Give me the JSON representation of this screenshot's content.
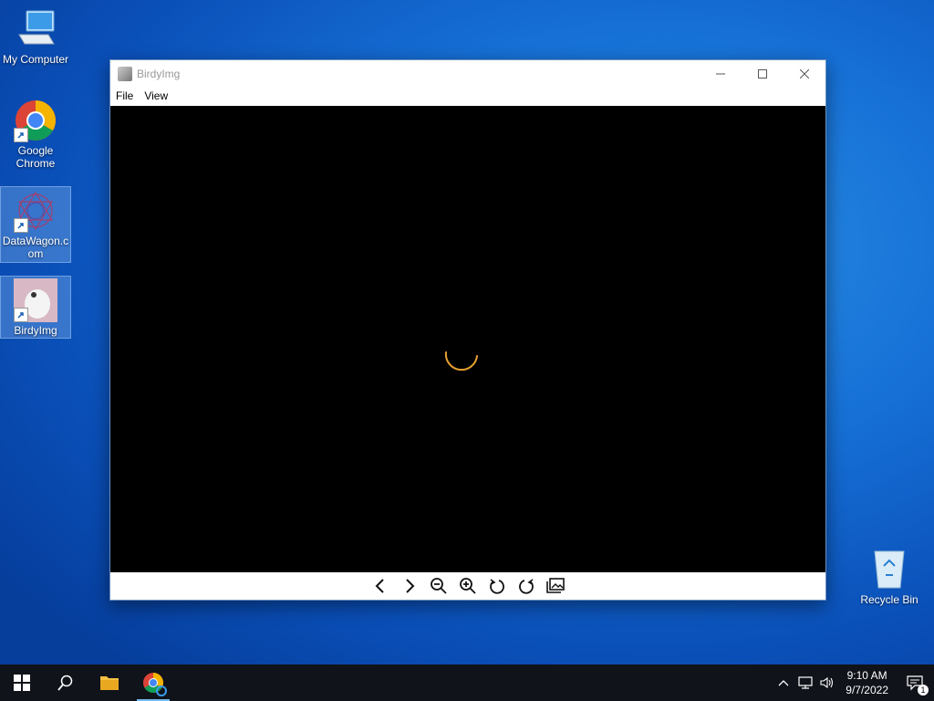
{
  "desktop": {
    "icons": [
      {
        "label": "My Computer"
      },
      {
        "label": "Google Chrome"
      },
      {
        "label": "DataWagon.com"
      },
      {
        "label": "BirdyImg"
      }
    ],
    "recycle_bin": "Recycle Bin"
  },
  "window": {
    "title": "BirdyImg",
    "menu": [
      "File",
      "View"
    ],
    "loading_color": "#e8a030",
    "toolbar_icons": [
      "previous-icon",
      "next-icon",
      "zoom-out-icon",
      "zoom-in-icon",
      "rotate-left-icon",
      "rotate-right-icon",
      "gallery-icon"
    ]
  },
  "taskbar": {
    "time": "9:10 AM",
    "date": "9/7/2022",
    "notification_count": "1"
  }
}
